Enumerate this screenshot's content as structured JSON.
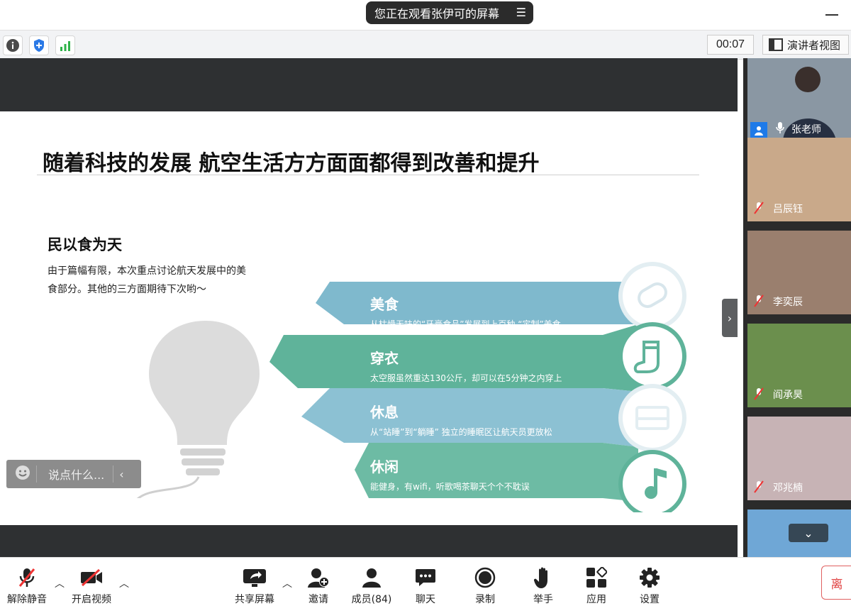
{
  "top": {
    "share_notice": "您正在观看张伊可的屏幕"
  },
  "infobar": {
    "timer": "00:07",
    "speaker_view_label": "演讲者视图"
  },
  "slide": {
    "title": "随着科技的发展 航空生活方方面面都得到改善和提升",
    "subtitle": "民以食为天",
    "description": "由于篇幅有限，本次重点讨论航天发展中的美食部分。其他的三方面期待下次哟～",
    "items": [
      {
        "title": "美食",
        "desc": "从枯燥无味的“牙膏食品”发展到上百种 “定制”美食",
        "icon": "bread-icon"
      },
      {
        "title": "穿衣",
        "desc": "太空服虽然重达130公斤，却可以在5分钟之内穿上",
        "icon": "sock-icon"
      },
      {
        "title": "休息",
        "desc": "从“站睡”到“躺睡” 独立的睡眠区让航天员更放松",
        "icon": "bed-icon"
      },
      {
        "title": "休闲",
        "desc": "能健身，有wifi，听歌喝茶聊天个个不耽误",
        "icon": "music-note-icon"
      }
    ]
  },
  "chat": {
    "placeholder": "说点什么..."
  },
  "participants": [
    {
      "name": "张老师",
      "muted": false
    },
    {
      "name": "吕辰钰",
      "muted": true
    },
    {
      "name": "李奕辰",
      "muted": true
    },
    {
      "name": "阎承昊",
      "muted": true
    },
    {
      "name": "邓兆楠",
      "muted": true
    }
  ],
  "toolbar": {
    "unmute": "解除静音",
    "start_video": "开启视频",
    "share_screen": "共享屏幕",
    "invite": "邀请",
    "members": "成员(84)",
    "chat": "聊天",
    "record": "录制",
    "raise_hand": "举手",
    "apps": "应用",
    "settings": "设置",
    "leave": "离"
  },
  "colors": {
    "ribbon_blue": "#7fb9cd",
    "ribbon_green": "#5fb39a",
    "dark_bar": "#2e3032"
  }
}
